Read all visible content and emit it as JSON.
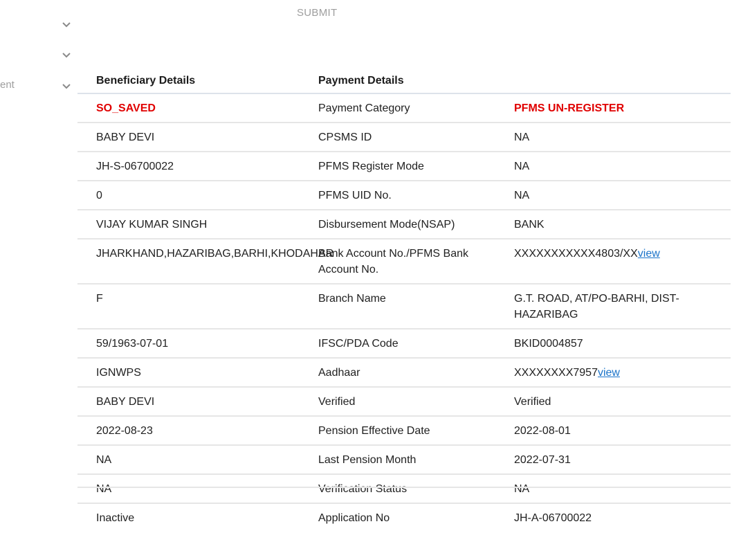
{
  "toolbar": {
    "submit_label": "SUBMIT"
  },
  "sidebar": {
    "cut_text": "ent"
  },
  "table": {
    "headers": [
      "Beneficiary Details",
      "Payment Details",
      ""
    ],
    "rows": [
      {
        "col1": "SO_SAVED",
        "col2": "Payment Category",
        "col3": "PFMS UN-REGISTER"
      },
      {
        "col1": "BABY DEVI",
        "col2": "CPSMS ID",
        "col3": "NA"
      },
      {
        "col1": "JH-S-06700022",
        "col2": "PFMS Register Mode",
        "col3": "NA"
      },
      {
        "col1": "0",
        "col2": "PFMS UID No.",
        "col3": "NA"
      },
      {
        "col1": "VIJAY KUMAR SINGH",
        "col2": "Disbursement Mode(NSAP)",
        "col3": "BANK"
      },
      {
        "col1": "JHARKHAND,HAZARIBAG,BARHI,KHODAHAR",
        "col2": "Bank Account No./PFMS Bank Account No.",
        "col3": "XXXXXXXXXXX4803/XX",
        "col3_link": "view"
      },
      {
        "col1": "F",
        "col2": "Branch Name",
        "col3": "G.T. ROAD, AT/PO-BARHI, DIST-HAZARIBAG"
      },
      {
        "col1": "59/1963-07-01",
        "col2": "IFSC/PDA Code",
        "col3": "BKID0004857"
      },
      {
        "col1": "IGNWPS",
        "col2": "Aadhaar",
        "col3": "XXXXXXXX7957",
        "col3_link": "view"
      },
      {
        "col1": "BABY DEVI",
        "col2": "Verified",
        "col3": "Verified"
      },
      {
        "col1": "2022-08-23",
        "col2": "Pension Effective Date",
        "col3": "2022-08-01"
      },
      {
        "col1": "NA",
        "col2": "Last Pension Month",
        "col3": "2022-07-31"
      },
      {
        "col1": "NA",
        "col2": "Verification Status",
        "col3": "NA"
      },
      {
        "col1": "Inactive",
        "col2": "Application No",
        "col3": "JH-A-06700022"
      }
    ]
  },
  "colors": {
    "status_red": "#e00000",
    "link_blue": "#1a73c9",
    "muted_gray": "#9e9e9e",
    "divider": "#e6e6e6"
  },
  "icons": [
    "chevron-down-icon",
    "chevron-down-icon",
    "chevron-down-icon"
  ]
}
